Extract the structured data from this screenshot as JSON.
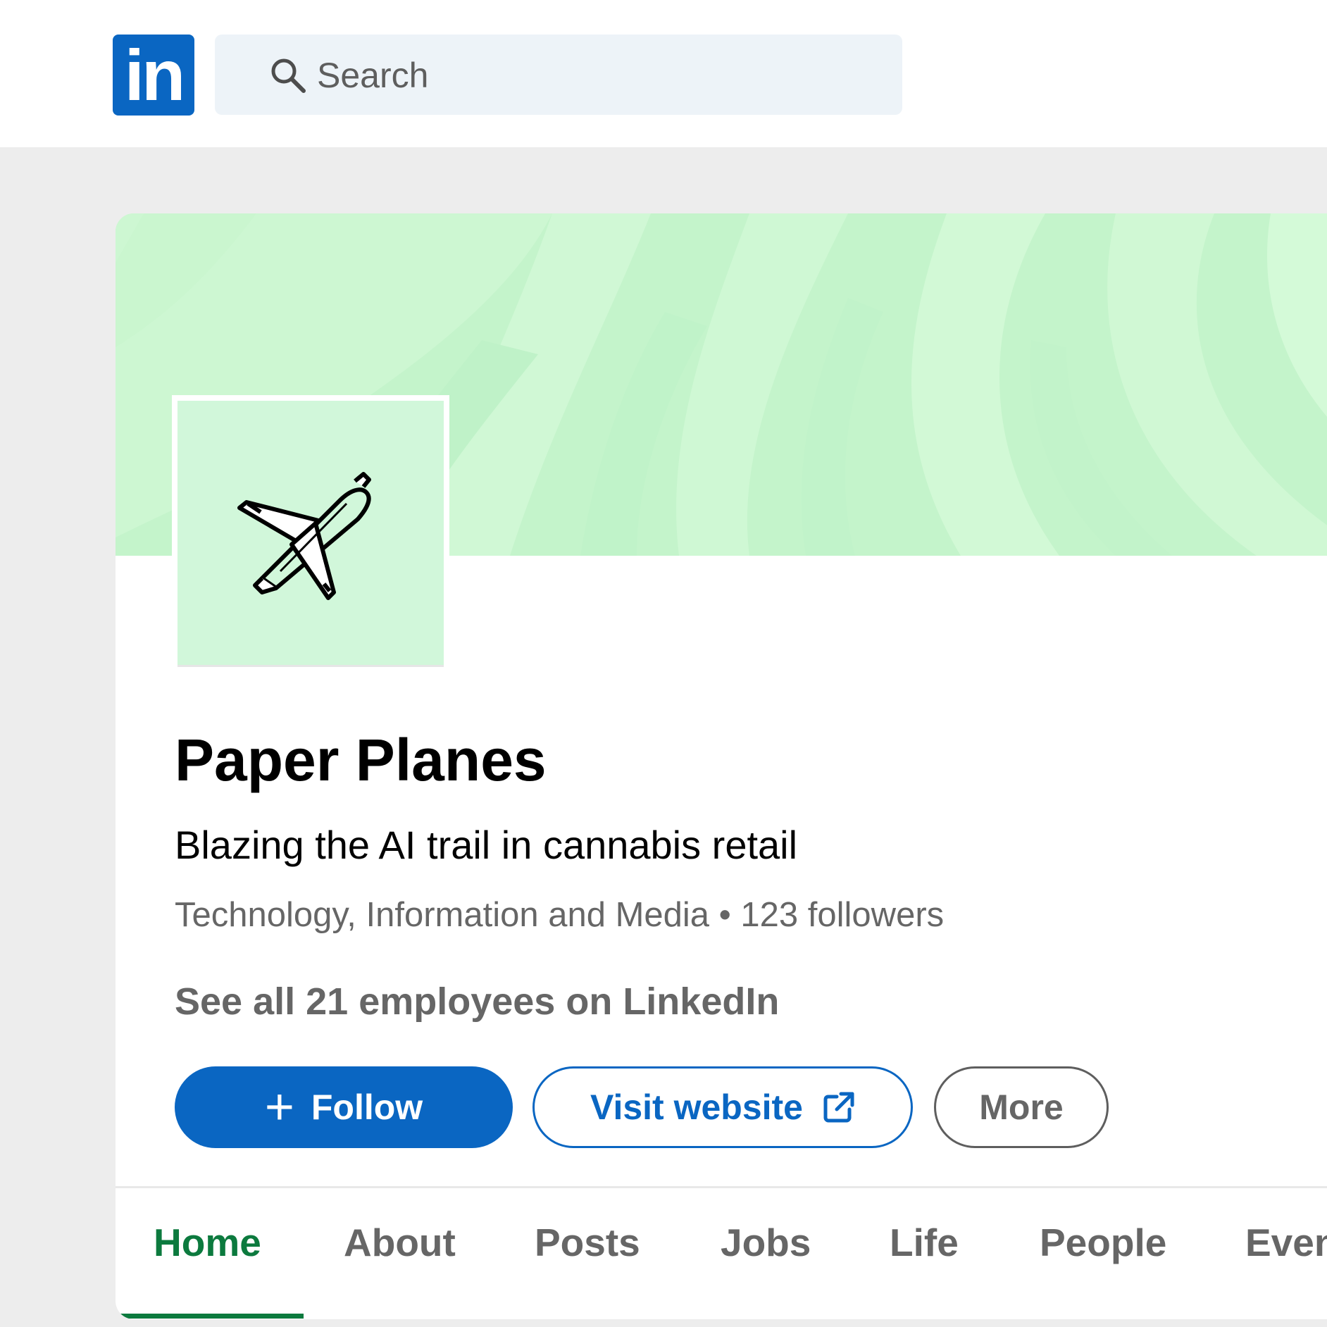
{
  "header": {
    "logo_text": "in",
    "search_placeholder": "Search"
  },
  "company": {
    "name": "Paper Planes",
    "tagline": "Blazing the AI trail in cannabis retail",
    "meta": "Technology, Information and Media • 123 followers",
    "employees_link": "See all 21 employees on LinkedIn"
  },
  "actions": {
    "follow_icon": "+",
    "follow_label": "Follow",
    "visit_label": "Visit website",
    "more_label": "More"
  },
  "tabs": [
    {
      "label": "Home",
      "active": true
    },
    {
      "label": "About"
    },
    {
      "label": "Posts"
    },
    {
      "label": "Jobs"
    },
    {
      "label": "Life"
    },
    {
      "label": "People"
    },
    {
      "label": "Events"
    }
  ],
  "colors": {
    "brand": "#0a66c2",
    "active_tab": "#0c7a3e",
    "banner": "#c8f5ce",
    "logo_bg": "#d1f7da"
  },
  "icons": {
    "search": "search-icon",
    "plane": "airplane-icon",
    "external": "external-link-icon"
  }
}
